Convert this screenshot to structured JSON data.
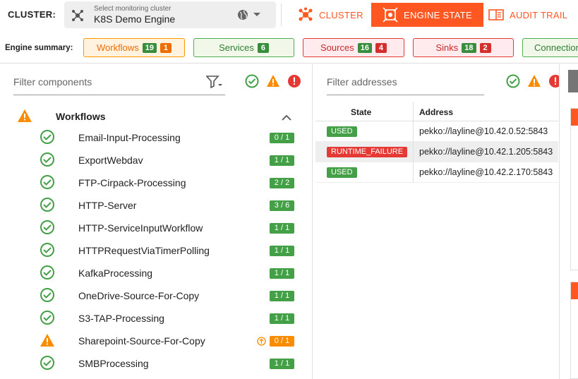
{
  "topbar": {
    "cluster_label": "CLUSTER:",
    "cluster_hint": "Select monitoring cluster",
    "cluster_value": "K8S Demo Engine",
    "nav": [
      {
        "label": "CLUSTER",
        "icon": "hub-icon"
      },
      {
        "label": "ENGINE STATE",
        "icon": "engine-icon"
      },
      {
        "label": "AUDIT TRAIL",
        "icon": "audit-book-icon"
      }
    ]
  },
  "summary": {
    "label": "Engine summary:",
    "chips": [
      {
        "label": "Workflows",
        "count": "19",
        "extra": "1"
      },
      {
        "label": "Services",
        "count": "6"
      },
      {
        "label": "Sources",
        "count": "16",
        "extra": "4"
      },
      {
        "label": "Sinks",
        "count": "18",
        "extra": "2"
      },
      {
        "label": "Connection"
      }
    ]
  },
  "components": {
    "filter_placeholder": "Filter components",
    "group_title": "Workflows",
    "rows": [
      {
        "name": "Email-Input-Processing",
        "count": "0 / 1",
        "status": "ok"
      },
      {
        "name": "ExportWebdav",
        "count": "1 / 1",
        "status": "ok"
      },
      {
        "name": "FTP-Cirpack-Processing",
        "count": "2 / 2",
        "status": "ok"
      },
      {
        "name": "HTTP-Server",
        "count": "3 / 6",
        "status": "ok"
      },
      {
        "name": "HTTP-ServiceInputWorkflow",
        "count": "1 / 1",
        "status": "ok"
      },
      {
        "name": "HTTPRequestViaTimerPolling",
        "count": "1 / 1",
        "status": "ok"
      },
      {
        "name": "KafkaProcessing",
        "count": "1 / 1",
        "status": "ok"
      },
      {
        "name": "OneDrive-Source-For-Copy",
        "count": "1 / 1",
        "status": "ok"
      },
      {
        "name": "S3-TAP-Processing",
        "count": "1 / 1",
        "status": "ok"
      },
      {
        "name": "Sharepoint-Source-For-Copy",
        "count": "0 / 1",
        "status": "warn"
      },
      {
        "name": "SMBProcessing",
        "count": "1 / 1",
        "status": "ok"
      }
    ]
  },
  "addresses": {
    "filter_placeholder": "Filter addresses",
    "col_state": "State",
    "col_address": "Address",
    "rows": [
      {
        "state": "USED",
        "address": "pekko://layline@10.42.0.52:5843"
      },
      {
        "state": "RUNTIME_FAILURE",
        "address": "pekko://layline@10.42.1.205:5843"
      },
      {
        "state": "USED",
        "address": "pekko://layline@10.42.2.170:5843"
      }
    ]
  },
  "colors": {
    "accent": "#ff5722",
    "ok": "#43a047",
    "warn": "#fb8c00",
    "error": "#e53935"
  }
}
